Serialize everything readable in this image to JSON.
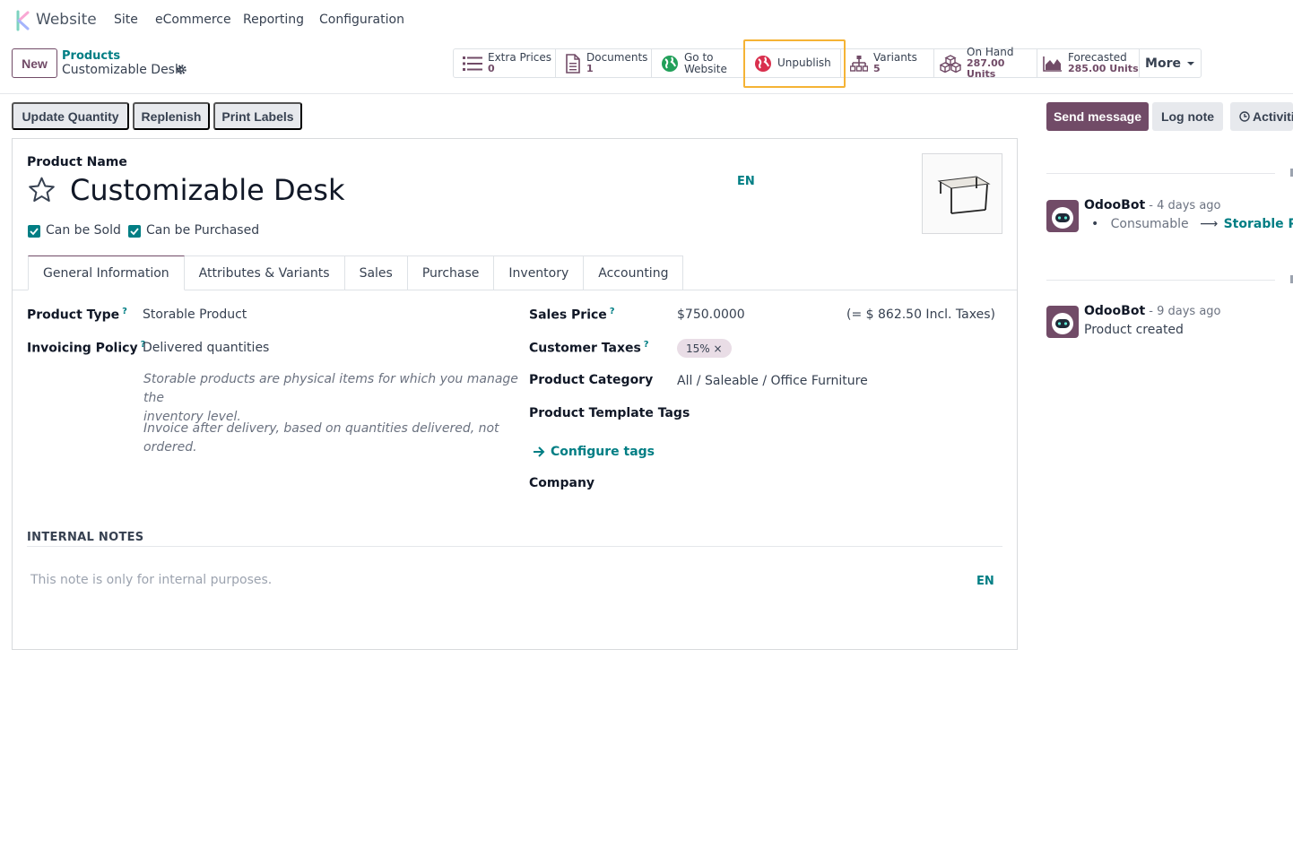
{
  "navbar": {
    "app_name": "Website",
    "menus": [
      "Site",
      "eCommerce",
      "Reporting",
      "Configuration"
    ]
  },
  "control_panel": {
    "new_label": "New",
    "breadcrumb_parent": "Products",
    "breadcrumb_current": "Customizable Desk",
    "smart_buttons": {
      "extra_prices": {
        "label": "Extra Prices",
        "value": "0"
      },
      "documents": {
        "label": "Documents",
        "value": "1"
      },
      "go_to_website": {
        "line1": "Go to",
        "line2": "Website"
      },
      "unpublish": {
        "label": "Unpublish"
      },
      "variants": {
        "label": "Variants",
        "value": "5"
      },
      "on_hand": {
        "label": "On Hand",
        "value": "287.00 Units"
      },
      "forecasted": {
        "label": "Forecasted",
        "value": "285.00 Units"
      },
      "more": "More"
    }
  },
  "statusbar": {
    "update_quantity": "Update Quantity",
    "replenish": "Replenish",
    "print_labels": "Print Labels"
  },
  "form": {
    "product_name_label": "Product Name",
    "product_name": "Customizable Desk",
    "lang": "EN",
    "can_be_sold": "Can be Sold",
    "can_be_purchased": "Can be Purchased",
    "tabs": [
      "General Information",
      "Attributes & Variants",
      "Sales",
      "Purchase",
      "Inventory",
      "Accounting"
    ],
    "tooltip_mark": "?",
    "left": {
      "product_type_label": "Product Type",
      "product_type": "Storable Product",
      "invoicing_policy_label": "Invoicing Policy",
      "invoicing_policy": "Delivered quantities",
      "help_line1": "Storable products are physical items for which you manage the",
      "help_line2": "inventory level.",
      "help_invoice": "Invoice after delivery, based on quantities delivered, not ordered."
    },
    "right": {
      "sales_price_label": "Sales Price",
      "sales_price": "$750.0000",
      "incl_taxes": "(= $ 862.50 Incl. Taxes)",
      "customer_taxes_label": "Customer Taxes",
      "tax_chip": "15% ×",
      "product_category_label": "Product Category",
      "product_category": "All / Saleable / Office Furniture",
      "template_tags_label": "Product Template Tags",
      "configure_tags": "Configure tags",
      "company_label": "Company"
    },
    "internal_notes_title": "INTERNAL NOTES",
    "internal_notes_placeholder": "This note is only for internal purposes.",
    "notes_lang": "EN"
  },
  "chatter": {
    "send_message": "Send message",
    "log_note": "Log note",
    "activities": "Activiti",
    "messages": [
      {
        "author": "OdooBot",
        "date": " - 4 days ago",
        "old": "Consumable",
        "arrow": "⟶",
        "new": "Storable Produ"
      },
      {
        "author": "OdooBot",
        "date": " - 9 days ago",
        "body": "Product created"
      }
    ]
  },
  "colors": {
    "brand": "#714B67",
    "link": "#017e84",
    "highlight": "#f5b335"
  }
}
